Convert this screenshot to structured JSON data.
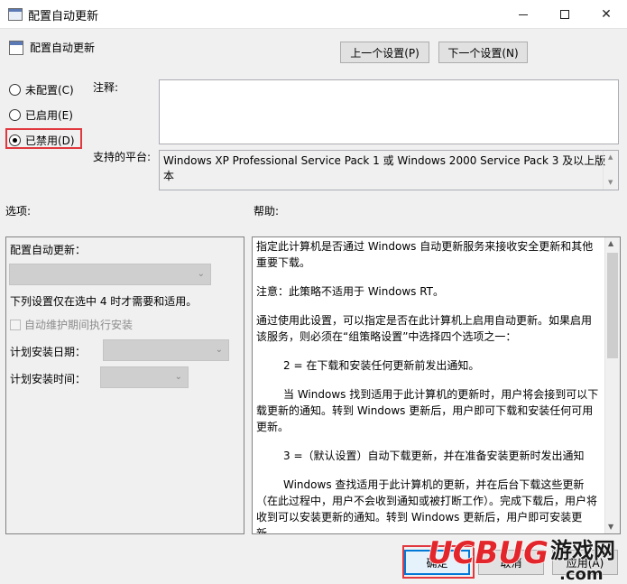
{
  "window": {
    "title": "配置自动更新",
    "minimize_icon": "minimize-icon",
    "maximize_icon": "maximize-icon",
    "close_icon": "close-icon",
    "close_glyph": "✕"
  },
  "header": {
    "policy_name": "配置自动更新",
    "prev_button": "上一个设置(P)",
    "next_button": "下一个设置(N)"
  },
  "state": {
    "options": [
      "未配置(C)",
      "已启用(E)",
      "已禁用(D)"
    ],
    "selected": "已禁用(D)"
  },
  "comment": {
    "label": "注释:",
    "value": ""
  },
  "platform": {
    "label": "支持的平台:",
    "value": "Windows XP Professional Service Pack 1 或 Windows 2000 Service Pack 3 及以上版本"
  },
  "options_label": "选项:",
  "help_label": "帮助:",
  "options_panel": {
    "title": "配置自动更新：",
    "main_combo_value": "",
    "note": "下列设置仅在选中 4 时才需要和适用。",
    "checkbox_label": "自动维护期间执行安装",
    "checkbox_checked": false,
    "day_label": "计划安装日期：",
    "day_value": "",
    "time_label": "计划安装时间：",
    "time_value": ""
  },
  "help": {
    "paragraphs": [
      "指定此计算机是否通过 Windows 自动更新服务来接收安全更新和其他重要下载。",
      "注意：此策略不适用于 Windows RT。",
      "通过使用此设置，可以指定是否在此计算机上启用自动更新。如果启用该服务，则必须在“组策略设置”中选择四个选项之一：",
      "2 = 在下载和安装任何更新前发出通知。",
      "当 Windows 找到适用于此计算机的更新时，用户将会接到可以下载更新的通知。转到 Windows 更新后，用户即可下载和安装任何可用更新。",
      "3 =（默认设置）自动下载更新，并在准备安装更新时发出通知",
      "Windows 查找适用于此计算机的更新，并在后台下载这些更新（在此过程中，用户不会收到通知或被打断工作）。完成下载后，用户将收到可以安装更新的通知。转到 Windows 更新后，用户即可安装更新。"
    ]
  },
  "footer": {
    "ok": "确定",
    "cancel": "取消",
    "apply": "应用(A)"
  },
  "watermark": {
    "brand": "UCBUG",
    "site_cn": "游戏网",
    "site_tld": ".com"
  },
  "colors": {
    "highlight": "#e0383e",
    "focus": "#0078d7",
    "background": "#f0f0f0"
  }
}
